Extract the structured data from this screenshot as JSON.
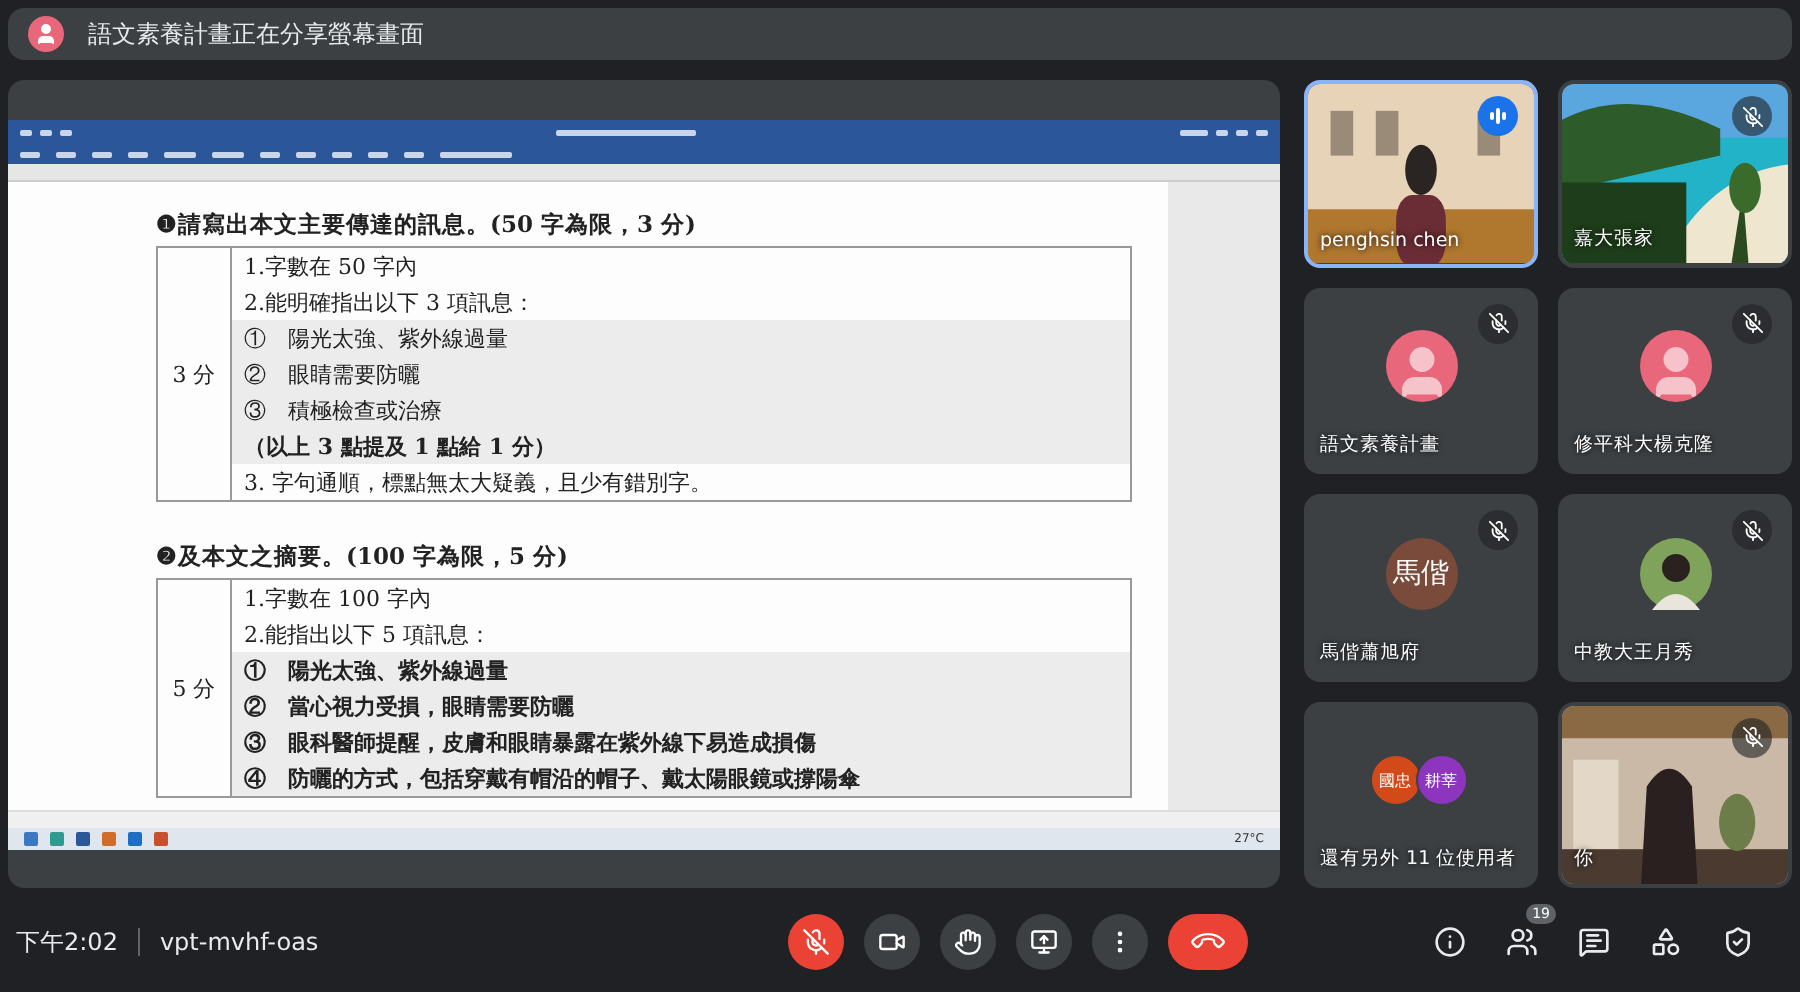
{
  "banner": {
    "text": "語文素養計畫正在分享螢幕畫面"
  },
  "shared_document": {
    "window": {
      "temperature": "27°C"
    },
    "sections": [
      {
        "heading": "❶請寫出本文主要傳達的訊息。(50 字為限，3 分)",
        "score": "3 分",
        "lines": [
          {
            "text": "1.字數在 50 字內",
            "shaded": false,
            "bold": false
          },
          {
            "text": "2.能明確指出以下 3 項訊息：",
            "shaded": false,
            "bold": false
          },
          {
            "text": "①　陽光太強、紫外線過量",
            "shaded": true,
            "bold": false
          },
          {
            "text": "②　眼睛需要防曬",
            "shaded": true,
            "bold": false
          },
          {
            "text": "③　積極檢查或治療",
            "shaded": true,
            "bold": false
          },
          {
            "text": "（以上 3 點提及 1 點給 1 分）",
            "shaded": true,
            "bold": true
          },
          {
            "text": "3. 字句通順，標點無太大疑義，且少有錯別字。",
            "shaded": false,
            "bold": false
          }
        ]
      },
      {
        "heading": "❷及本文之摘要。(100 字為限，5 分)",
        "score": "5 分",
        "lines": [
          {
            "text": "1.字數在 100 字內",
            "shaded": false,
            "bold": false
          },
          {
            "text": "2.能指出以下 5 項訊息：",
            "shaded": false,
            "bold": false
          },
          {
            "text": "①　陽光太強、紫外線過量",
            "shaded": true,
            "bold": true
          },
          {
            "text": "②　當心視力受損，眼睛需要防曬",
            "shaded": true,
            "bold": true
          },
          {
            "text": "③　眼科醫師提醒，皮膚和眼睛暴露在紫外線下易造成損傷",
            "shaded": true,
            "bold": true
          },
          {
            "text": "④　防曬的方式，包括穿戴有帽沿的帽子、戴太陽眼鏡或撐陽傘",
            "shaded": true,
            "bold": true
          }
        ]
      }
    ]
  },
  "participants": [
    {
      "name": "penghsin chen",
      "kind": "video",
      "mic_muted": false,
      "speaking": true,
      "active": true
    },
    {
      "name": "嘉大張家",
      "kind": "beach",
      "mic_muted": true,
      "speaking": false,
      "active": false
    },
    {
      "name": "語文素養計畫",
      "kind": "avatar",
      "mic_muted": true,
      "speaking": false,
      "active": false
    },
    {
      "name": "修平科大楊克隆",
      "kind": "avatar",
      "mic_muted": true,
      "speaking": false,
      "active": false
    },
    {
      "name": "馬偕蕭旭府",
      "kind": "initials",
      "initials": "馬偕",
      "color": "#7a4a3a",
      "mic_muted": true,
      "speaking": false,
      "active": false
    },
    {
      "name": "中教大王月秀",
      "mic_muted": true,
      "speaking": false,
      "active": false
    },
    {
      "name": "還有另外 11 位使用者",
      "kind": "group",
      "chips": [
        {
          "text": "國忠",
          "color": "#d24a1a"
        },
        {
          "text": "耕莘",
          "color": "#8e35c0"
        }
      ],
      "mic_muted": false,
      "speaking": false,
      "active": false
    },
    {
      "name": "你",
      "kind": "self",
      "mic_muted": true,
      "speaking": false,
      "active": false
    }
  ],
  "bottom_bar": {
    "time": "下午2:02",
    "meeting_code": "vpt-mvhf-oas",
    "mic_muted": true,
    "people_count": "19"
  }
}
